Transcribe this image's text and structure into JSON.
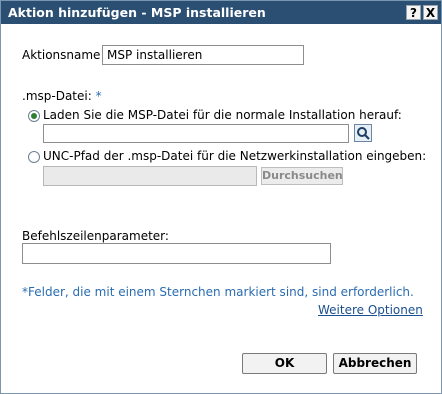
{
  "window": {
    "title": "Aktion hinzufügen - MSP installieren",
    "help_glyph": "?",
    "close_glyph": "X"
  },
  "form": {
    "action_name_label": "Aktionsname",
    "action_name_value": "MSP installieren",
    "msp_file_label": ".msp-Datei:",
    "required_mark": "*",
    "radio_upload_label": "Laden Sie die MSP-Datei für die normale Installation herauf:",
    "upload_path_value": "",
    "radio_unc_label": "UNC-Pfad der .msp-Datei für die Netzwerkinstallation eingeben:",
    "unc_path_value": "",
    "browse_label": "Durchsuchen",
    "cmdline_label": "Befehlszeilenparameter:",
    "cmdline_value": "",
    "required_note": "*Felder, die mit einem Sternchen markiert sind, sind erforderlich.",
    "more_options_link": "Weitere Optionen"
  },
  "footer": {
    "ok_label": "OK",
    "cancel_label": "Abbrechen"
  },
  "icons": {
    "browse_file": "magnifier-icon",
    "help": "help-icon",
    "close": "close-icon"
  },
  "colors": {
    "titlebar": "#2b4f73",
    "required": "#2a6cb0",
    "link": "#1a4f8f",
    "radio_selected": "#2e7d32"
  }
}
